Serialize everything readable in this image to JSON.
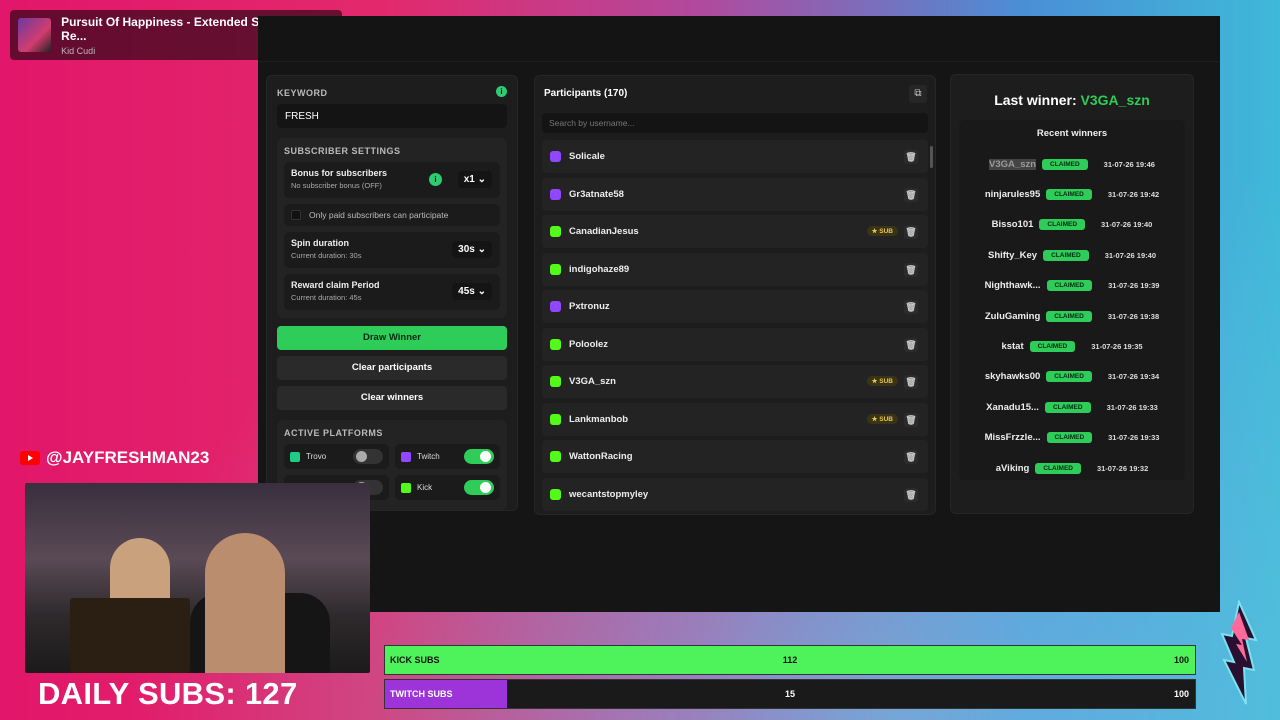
{
  "now_playing": {
    "title": "Pursuit Of Happiness - Extended Steve Aoki Re...",
    "artist": "Kid Cudi"
  },
  "keyword": {
    "label": "KEYWORD",
    "value": "FRESH"
  },
  "subscriber_settings": {
    "label": "SUBSCRIBER SETTINGS",
    "bonus": {
      "title": "Bonus for subscribers",
      "sub": "No subscriber bonus (OFF)",
      "value": "x1"
    },
    "only_paid": "Only paid subscribers can participate",
    "spin": {
      "title": "Spin duration",
      "sub": "Current duration: 30s",
      "value": "30s"
    },
    "claim": {
      "title": "Reward claim Period",
      "sub": "Current duration: 45s",
      "value": "45s"
    }
  },
  "buttons": {
    "draw": "Draw Winner",
    "clear_participants": "Clear participants",
    "clear_winners": "Clear winners"
  },
  "platforms": {
    "label": "ACTIVE PLATFORMS",
    "items": [
      {
        "name": "Trovo",
        "on": false,
        "color": "#1fcc83"
      },
      {
        "name": "Twitch",
        "on": true,
        "color": "#9146ff"
      },
      {
        "name": "",
        "on": false,
        "color": "#d33"
      },
      {
        "name": "Kick",
        "on": true,
        "color": "#53fc18"
      }
    ]
  },
  "participants": {
    "title": "Participants (170)",
    "search_placeholder": "Search by username...",
    "items": [
      {
        "name": "Solicale",
        "platform": "twitch",
        "sub": false
      },
      {
        "name": "Gr3atnate58",
        "platform": "twitch",
        "sub": false
      },
      {
        "name": "CanadianJesus",
        "platform": "kick",
        "sub": true
      },
      {
        "name": "indigohaze89",
        "platform": "kick",
        "sub": false
      },
      {
        "name": "Pxtronuz",
        "platform": "twitch",
        "sub": false
      },
      {
        "name": "Poloolez",
        "platform": "kick",
        "sub": false
      },
      {
        "name": "V3GA_szn",
        "platform": "kick",
        "sub": true
      },
      {
        "name": "Lankmanbob",
        "platform": "kick",
        "sub": true
      },
      {
        "name": "WattonRacing",
        "platform": "kick",
        "sub": false
      },
      {
        "name": "wecantstopmyley",
        "platform": "kick",
        "sub": false
      }
    ],
    "sub_label": "★ SUB"
  },
  "last_winner": {
    "prefix": "Last winner: ",
    "name": "V3GA_szn"
  },
  "recent_winners": {
    "title": "Recent winners",
    "claimed_label": "CLAIMED",
    "items": [
      {
        "name": "V3GA_szn",
        "date": "31-07-26 19:46"
      },
      {
        "name": "ninjarules95",
        "date": "31-07-26 19:42"
      },
      {
        "name": "Bisso101",
        "date": "31-07-26 19:40"
      },
      {
        "name": "Shifty_Key",
        "date": "31-07-26 19:40"
      },
      {
        "name": "Nighthawk...",
        "date": "31-07-26 19:39"
      },
      {
        "name": "ZuluGaming",
        "date": "31-07-26 19:38"
      },
      {
        "name": "kstat",
        "date": "31-07-26 19:35"
      },
      {
        "name": "skyhawks00",
        "date": "31-07-26 19:34"
      },
      {
        "name": "Xanadu15...",
        "date": "31-07-26 19:33"
      },
      {
        "name": "MissFrzzle...",
        "date": "31-07-26 19:33"
      },
      {
        "name": "aViking",
        "date": "31-07-26 19:32"
      }
    ]
  },
  "social": {
    "handle": "@JAYFRESHMAN23"
  },
  "daily_subs": "DAILY SUBS: 127",
  "sub_bars": [
    {
      "label": "KICK SUBS",
      "value": 112,
      "max": 100,
      "color": "#4ef25a",
      "cls": "kick"
    },
    {
      "label": "TWITCH SUBS",
      "value": 15,
      "max": 100,
      "color": "#9c34d9",
      "cls": "twitch"
    }
  ]
}
